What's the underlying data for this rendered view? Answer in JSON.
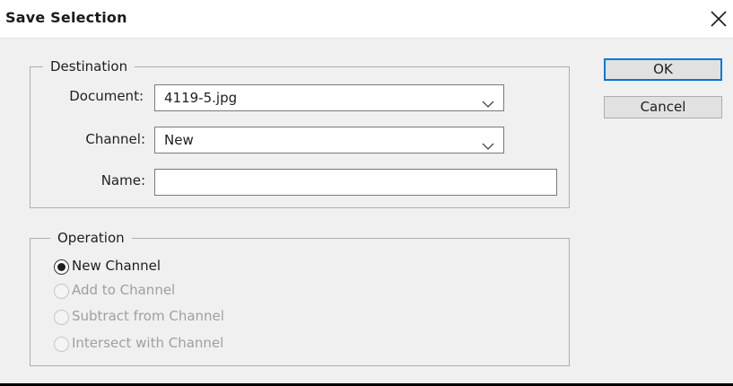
{
  "window": {
    "title": "Save Selection"
  },
  "buttons": {
    "ok": "OK",
    "cancel": "Cancel"
  },
  "destination": {
    "legend": "Destination",
    "document_label": "Document:",
    "document_value": "4119-5.jpg",
    "channel_label": "Channel:",
    "channel_value": "New",
    "name_label": "Name:",
    "name_value": ""
  },
  "operation": {
    "legend": "Operation",
    "options": [
      {
        "label": "New Channel",
        "checked": true,
        "enabled": true
      },
      {
        "label": "Add to Channel",
        "checked": false,
        "enabled": false
      },
      {
        "label": "Subtract from Channel",
        "checked": false,
        "enabled": false
      },
      {
        "label": "Intersect with Channel",
        "checked": false,
        "enabled": false
      }
    ]
  },
  "icons": {
    "close": "close-icon",
    "dropdown": "chevron-down-icon"
  },
  "colors": {
    "default_button_border": "#0078d7",
    "disabled_text": "#9f9f9f",
    "background": "#f0f0f0"
  }
}
